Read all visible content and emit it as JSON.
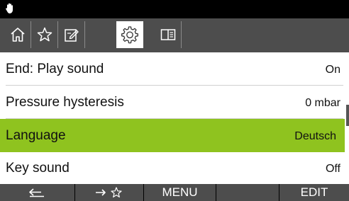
{
  "status_bar": {
    "icon": "hand-icon"
  },
  "tabs": [
    {
      "icon": "home-icon",
      "active": false
    },
    {
      "icon": "star-icon",
      "active": false
    },
    {
      "icon": "edit-icon",
      "active": false
    },
    {
      "icon": "gear-icon",
      "active": true
    },
    {
      "icon": "book-icon",
      "active": false
    }
  ],
  "settings": [
    {
      "label": "End: Play sound",
      "value": "On"
    },
    {
      "label": "Pressure hysteresis",
      "value": "0 mbar"
    },
    {
      "label": "Language",
      "value": "Deutsch",
      "selected": true
    },
    {
      "label": "Key sound",
      "value": "Off"
    }
  ],
  "softkeys": {
    "back": {
      "icon": "back-arrow-icon"
    },
    "favorite": {
      "icon": "arrow-star-icon"
    },
    "menu": {
      "label": "MENU"
    },
    "empty": {
      "label": ""
    },
    "edit": {
      "label": "EDIT"
    }
  },
  "colors": {
    "accent": "#8fc31f",
    "bar": "#4d4d4d",
    "status": "#000000"
  }
}
